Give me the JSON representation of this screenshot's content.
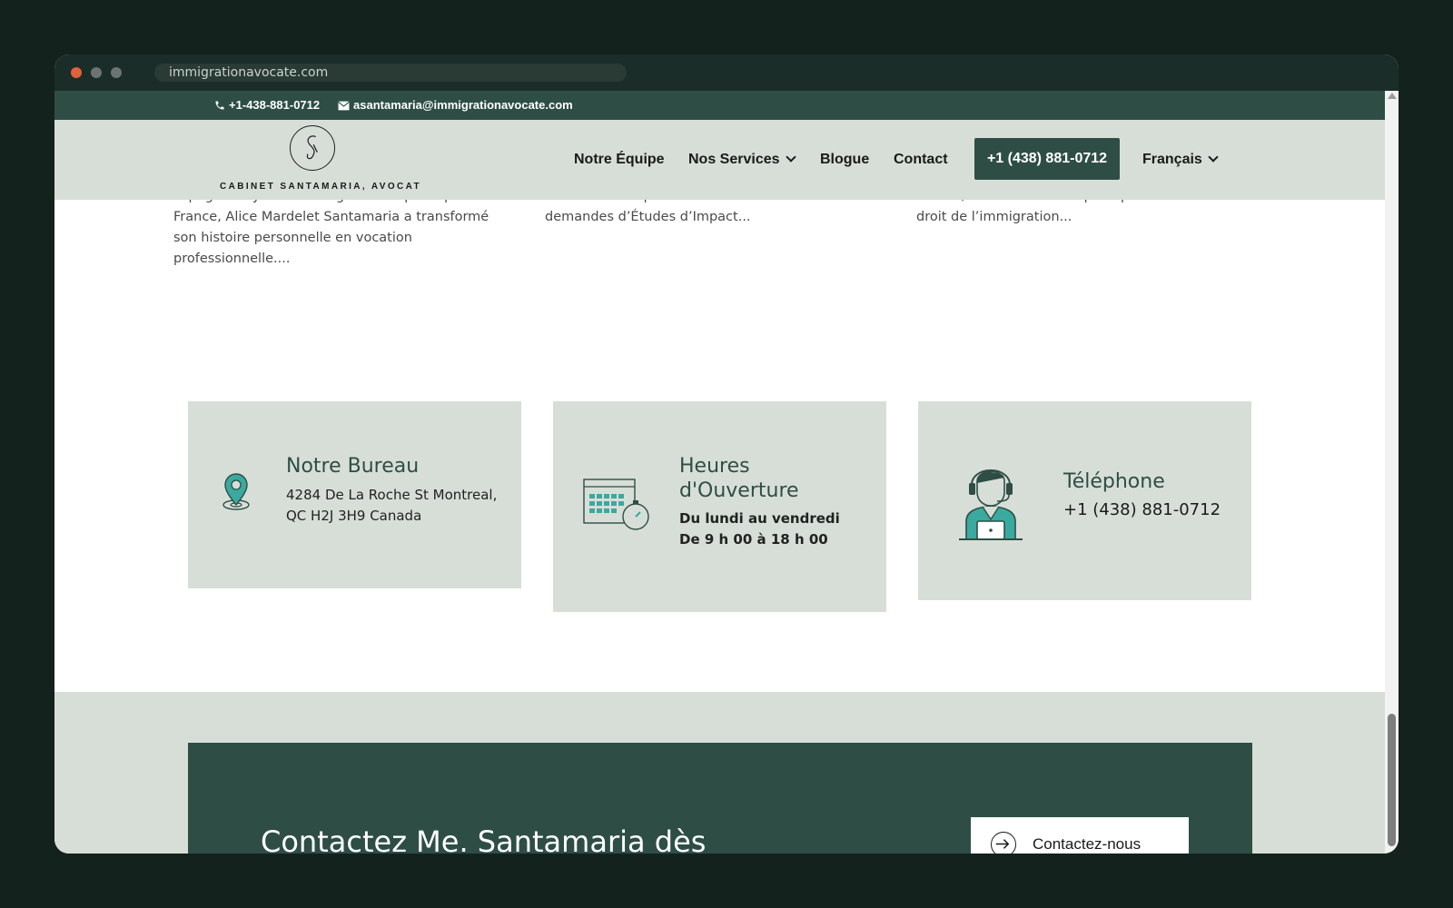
{
  "browser": {
    "url": "immigrationavocate.com"
  },
  "topbar": {
    "phone": "+1-438-881-0712",
    "email": "asantamaria@immigrationavocate.com"
  },
  "header": {
    "logo_text": "CABINET SANTAMARIA, AVOCAT",
    "nav": [
      {
        "label": "Notre Équipe"
      },
      {
        "label": "Nos Services"
      },
      {
        "label": "Blogue"
      },
      {
        "label": "Contact"
      }
    ],
    "call_button": "+1 (438) 881-0712",
    "language": "Français"
  },
  "excerpts": [
    {
      "lines": [
        "espagnols ayant fui le régime franquiste pour la",
        "France, Alice Mardelet Santamaria a transformé",
        "son histoire personnelle en vocation",
        "professionnelle...."
      ]
    },
    {
      "lines": [
        "canadien a suspendu le traitement des",
        "demandes d’Études d’Impact..."
      ]
    },
    {
      "lines": [
        "Avocat, un cabinet dédié principalement au",
        "droit de l’immigration..."
      ]
    }
  ],
  "info_cards": {
    "office": {
      "title": "Notre Bureau",
      "line1": "4284 De La Roche St Montreal,",
      "line2": "QC H2J 3H9 Canada"
    },
    "hours": {
      "title_line1": "Heures",
      "title_line2": "d'Ouverture",
      "line1": "Du lundi au vendredi",
      "line2": "De 9 h 00 à 18 h 00"
    },
    "phone": {
      "title": "Téléphone",
      "number": "+1 (438) 881-0712"
    }
  },
  "cta": {
    "title": "Contactez Me. Santamaria dès",
    "button": "Contactez-nous"
  },
  "colors": {
    "brand_dark": "#2e4e45",
    "brand_light": "#d7ded8",
    "icon_teal": "#3aa99f"
  }
}
